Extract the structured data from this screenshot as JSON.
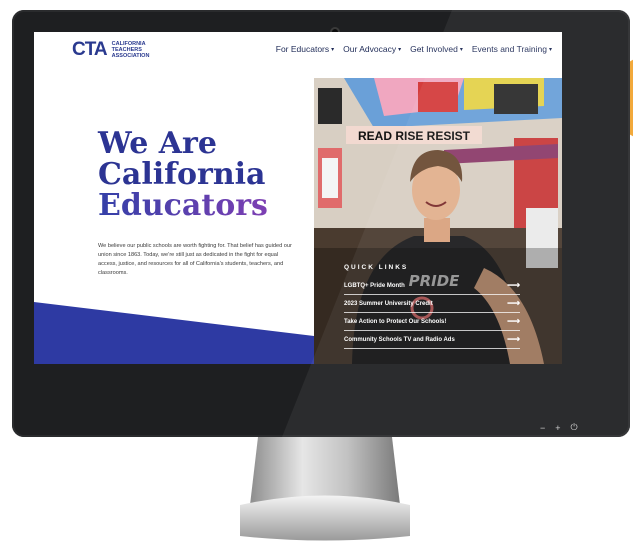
{
  "brand": {
    "logo_mark": "CTA",
    "logo_lines": [
      "CALIFORNIA",
      "TEACHERS",
      "ASSOCIATION"
    ]
  },
  "nav": {
    "items": [
      {
        "label": "For Educators"
      },
      {
        "label": "Our Advocacy"
      },
      {
        "label": "Get Involved"
      },
      {
        "label": "Events and Training"
      }
    ]
  },
  "hero": {
    "title_lines": [
      "We Are",
      "California",
      "Educators"
    ],
    "description": "We believe our public schools are worth fighting for. That belief has guided our union since 1863. Today, we’re still just as dedicated in the fight for equal access, justice, and resources for all of California’s students, teachers, and classrooms."
  },
  "photo": {
    "sign_text": "READ RISE RESIST",
    "shirt_text": "PRIDE"
  },
  "quick_links": {
    "title": "QUICK LINKS",
    "items": [
      {
        "label": "LGBTQ+ Pride Month"
      },
      {
        "label": "2023 Summer University Credit"
      },
      {
        "label": "Take Action to Protect Our Schools!"
      },
      {
        "label": "Community Schools TV and Radio Ads"
      }
    ]
  },
  "monitor_controls": [
    "−",
    "+",
    "⏻"
  ],
  "colors": {
    "brand_blue": "#2c3493",
    "accent_orange": "#f2a93b",
    "stripe_blue": "#2e3aa3"
  }
}
